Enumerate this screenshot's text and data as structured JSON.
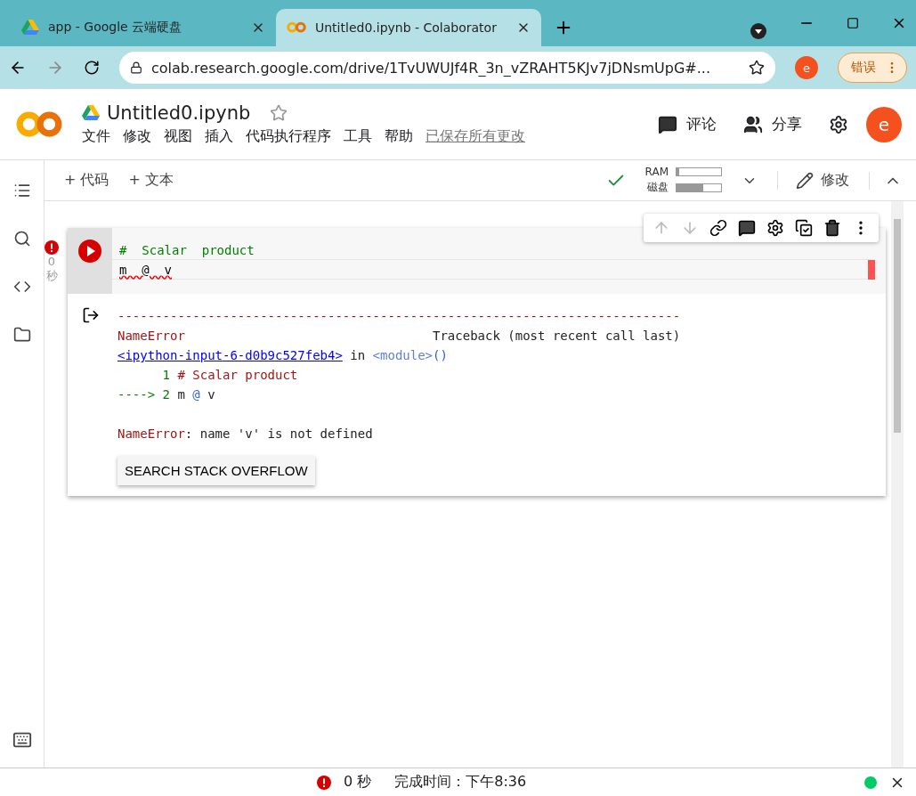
{
  "browser": {
    "tabs": [
      {
        "title": "app - Google 云端硬盘",
        "kind": "drive",
        "selected": false
      },
      {
        "title": "Untitled0.ipynb - Colaborator",
        "kind": "colab",
        "selected": true
      }
    ],
    "url": "colab.research.google.com/drive/1TvUWUJf4R_3n_vZRAHT5KJv7jDNsmUpG#...",
    "profile": "e",
    "error_button": "错误"
  },
  "header": {
    "notebook_title": "Untitled0.ipynb",
    "menu": [
      "文件",
      "修改",
      "视图",
      "插入",
      "代码执行程序",
      "工具",
      "帮助"
    ],
    "save_status": "已保存所有更改",
    "comment": "评论",
    "share": "分享",
    "avatar": "e"
  },
  "toolbar": {
    "add_code": "+ 代码",
    "add_text": "+ 文本",
    "ram_label": "RAM",
    "ram": {
      "level": 0.05
    },
    "disk_label": "磁盘",
    "disk": {
      "level": 0.6
    },
    "edit": "修改"
  },
  "cell": {
    "status_count": "0",
    "status_unit": "秒",
    "code": [
      {
        "text": "#  Scalar  product",
        "kind": "comment",
        "error_underline": false
      },
      {
        "text": "m  @  v",
        "kind": "code",
        "error_underline": true
      }
    ],
    "traceback": [
      [
        {
          "text": "---------------------------------------------------------------------------",
          "kind": "exc"
        }
      ],
      [
        {
          "text": "NameError                                 ",
          "kind": "exc"
        },
        {
          "text": "Traceback (most recent call last)",
          "kind": "plain"
        }
      ],
      [
        {
          "text": "<ipython-input-6-d0b9c527feb4>",
          "kind": "link"
        },
        {
          "text": " in ",
          "kind": "plain"
        },
        {
          "text": "<module>",
          "kind": "module"
        },
        {
          "text": "()",
          "kind": "op"
        }
      ],
      [
        {
          "text": "      1 ",
          "kind": "lineno"
        },
        {
          "text": "# Scalar product",
          "kind": "exc"
        }
      ],
      [
        {
          "text": "----> 2 ",
          "kind": "lineno"
        },
        {
          "text": "m ",
          "kind": "plain"
        },
        {
          "text": "@",
          "kind": "op"
        },
        {
          "text": " v",
          "kind": "plain"
        }
      ]
    ],
    "error_message": [
      {
        "text": "NameError",
        "kind": "exc"
      },
      {
        "text": ": name 'v' is not defined",
        "kind": "plain"
      }
    ],
    "search_button": "SEARCH STACK OVERFLOW"
  },
  "status_bar": {
    "duration": "0 秒",
    "finished": "完成时间：下午8:36"
  }
}
